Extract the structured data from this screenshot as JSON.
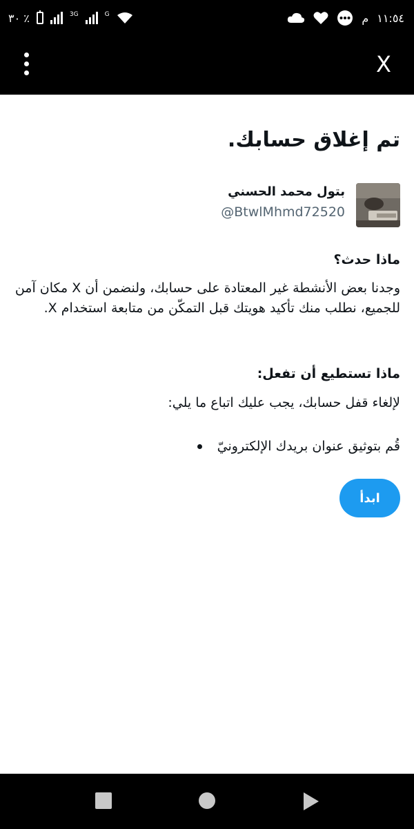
{
  "status_bar": {
    "battery_text": "٣٠ ٪",
    "network_3g": "3G",
    "network_g": "G",
    "time": "١١:٥٤",
    "ampm": "م"
  },
  "app_bar": {
    "close_label": "X"
  },
  "page": {
    "title": "تم إغلاق حسابك.",
    "user": {
      "name": "بتول محمد الحسني",
      "handle": "@BtwlMhmd72520"
    },
    "what_happened": {
      "heading": "ماذا حدث؟",
      "body": "وجدنا بعض الأنشطة غير المعتادة على حسابك، ولنضمن أن X مكان آمن للجميع، نطلب منك تأكيد هويتك قبل التمكّن من متابعة استخدام X."
    },
    "what_to_do": {
      "heading": "ماذا تستطيع أن تفعل:",
      "intro": "لإلغاء قفل حسابك، يجب عليك اتباع ما يلي:",
      "steps": [
        "قُم بتوثيق عنوان بريدك الإلكترونيّ"
      ]
    },
    "start_button": "ابدأ"
  },
  "colors": {
    "accent": "#1d9bf0",
    "text": "#0f1419",
    "muted": "#536471",
    "bars": "#000000"
  }
}
